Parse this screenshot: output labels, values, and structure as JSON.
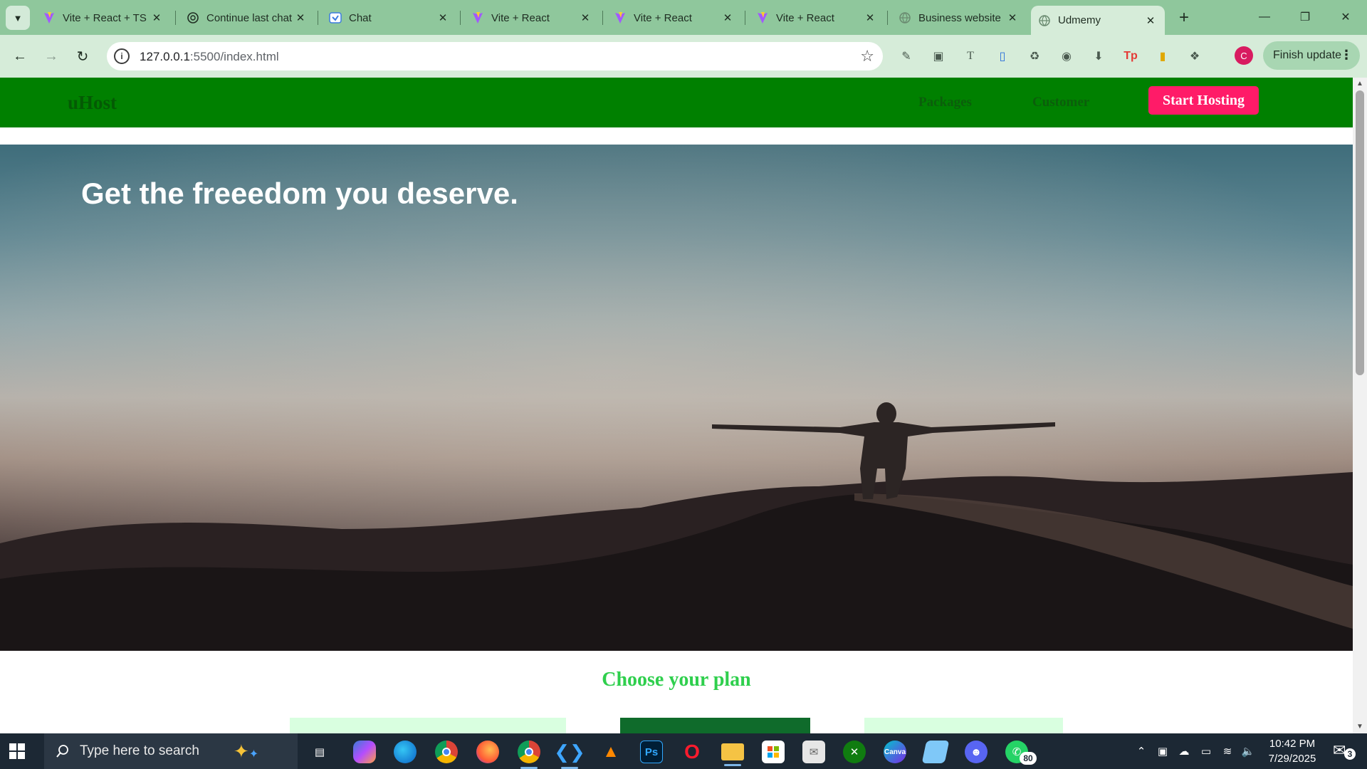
{
  "browser": {
    "tabs": [
      {
        "title": "Vite + React + TS",
        "icon": "vite-icon"
      },
      {
        "title": "Continue last chat",
        "icon": "chatgpt-icon"
      },
      {
        "title": "Chat",
        "icon": "chat-app-icon"
      },
      {
        "title": "Vite + React",
        "icon": "vite-icon"
      },
      {
        "title": "Vite + React",
        "icon": "vite-icon"
      },
      {
        "title": "Vite + React",
        "icon": "vite-icon"
      },
      {
        "title": "Business website",
        "icon": "globe-icon"
      },
      {
        "title": "Udmemy",
        "icon": "globe-icon",
        "active": true
      }
    ],
    "url_host": "127.0.0.1",
    "url_path": ":5500/index.html",
    "profile_initial": "C",
    "finish_update_label": "Finish update"
  },
  "site": {
    "logo": "uHost",
    "nav": {
      "packages": "Packages",
      "customers": "Customer",
      "cta": "Start Hosting"
    },
    "hero_title": "Get the freeedom you deserve.",
    "plans_title": "Choose your plan",
    "colors": {
      "header_bg": "#008000",
      "cta_bg": "#ff1b68",
      "plans_title": "#2fcf4d",
      "plan_card_light": "#d9ffe0",
      "plan_card_dark": "#0f6b2b"
    }
  },
  "taskbar": {
    "search_placeholder": "Type here to search",
    "time": "10:42 PM",
    "date": "7/29/2025",
    "whatsapp_badge": "80",
    "notification_count": "3",
    "apps": [
      "task-view-icon",
      "copilot-icon",
      "edge-icon",
      "chrome-icon",
      "firefox-icon",
      "chrome-dev-icon",
      "vscode-icon",
      "vlc-icon",
      "photoshop-icon",
      "opera-icon",
      "file-explorer-icon",
      "microsoft-store-icon",
      "mail-icon",
      "xbox-icon",
      "canva-icon",
      "notepad-icon",
      "discord-icon",
      "whatsapp-icon"
    ]
  }
}
